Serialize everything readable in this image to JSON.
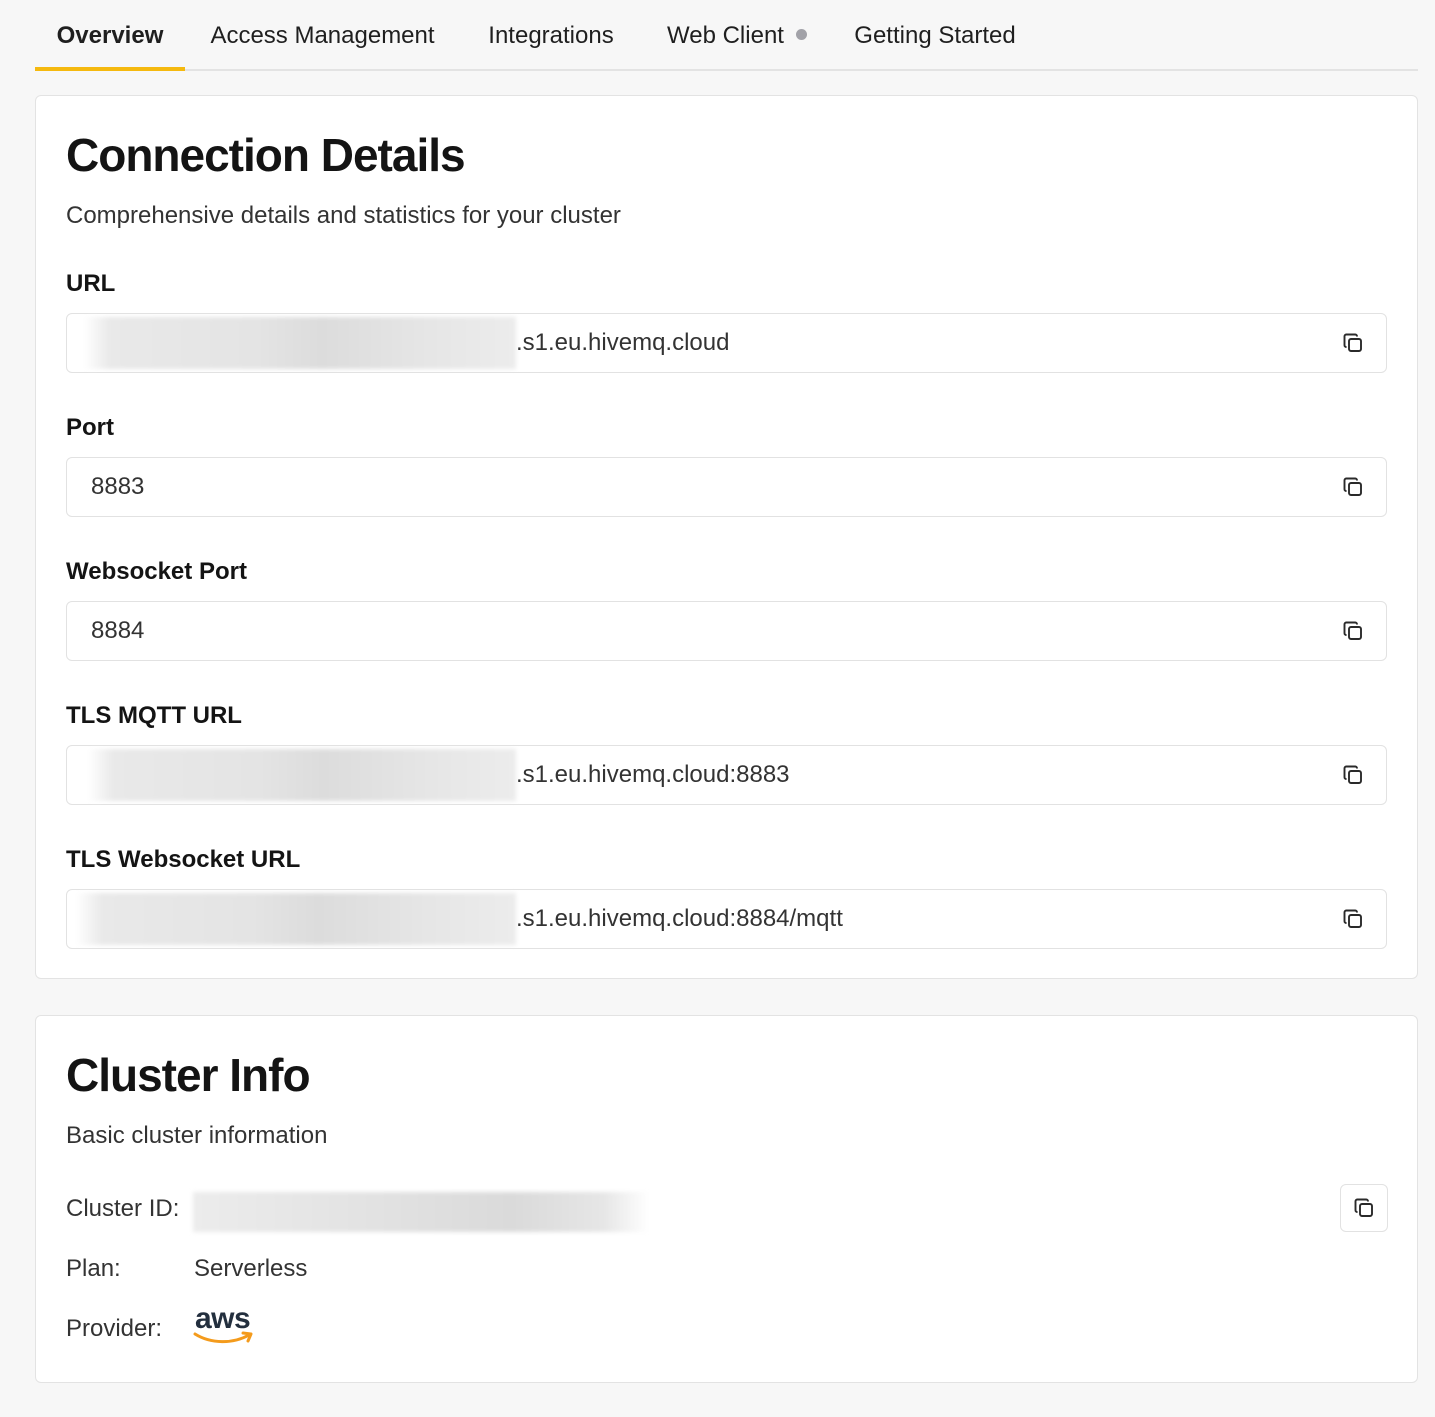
{
  "tabs": [
    {
      "label": "Overview",
      "active": true
    },
    {
      "label": "Access Management",
      "active": false
    },
    {
      "label": "Integrations",
      "active": false
    },
    {
      "label": "Web Client",
      "active": false,
      "status_dot": true
    },
    {
      "label": "Getting Started",
      "active": false
    }
  ],
  "accent_color": "#f5b90f",
  "connection": {
    "title": "Connection Details",
    "subtitle": "Comprehensive details and statistics for your cluster",
    "fields": [
      {
        "label": "URL",
        "value": ".s1.eu.hivemq.cloud",
        "redacted_prefix": true
      },
      {
        "label": "Port",
        "value": "8883",
        "redacted_prefix": false
      },
      {
        "label": "Websocket Port",
        "value": "8884",
        "redacted_prefix": false
      },
      {
        "label": "TLS MQTT URL",
        "value": ".s1.eu.hivemq.cloud:8883",
        "redacted_prefix": true
      },
      {
        "label": "TLS Websocket URL",
        "value": ".s1.eu.hivemq.cloud:8884/mqtt",
        "redacted_prefix": true
      }
    ],
    "copy_icon": "copy-icon"
  },
  "cluster": {
    "title": "Cluster Info",
    "subtitle": "Basic cluster information",
    "id_label": "Cluster ID:",
    "plan_label": "Plan:",
    "plan_value": "Serverless",
    "provider_label": "Provider:",
    "provider_logo": "aws"
  }
}
